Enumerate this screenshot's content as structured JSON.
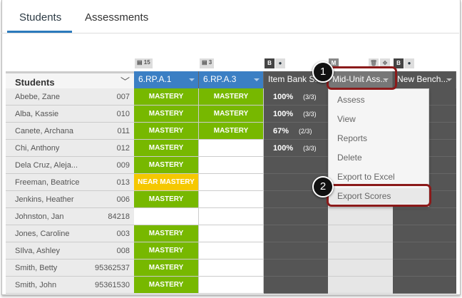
{
  "tabs": [
    {
      "label": "Students"
    },
    {
      "label": "Assessments"
    }
  ],
  "students_header": "Students",
  "badges": {
    "c1": "15",
    "c2": "3",
    "item_bank": "B",
    "mid_unit": "M",
    "new_bench": "B"
  },
  "columns": [
    {
      "label": "6.RP.A.1",
      "color": "#3b7fc4"
    },
    {
      "label": "6.RP.A.3",
      "color": "#3b7fc4"
    },
    {
      "label": "Item Bank S...",
      "color": "#555555"
    },
    {
      "label": "Mid-Unit Ass...",
      "color": "#777777"
    },
    {
      "label": "New Bench...",
      "color": "#555555"
    }
  ],
  "rows": [
    {
      "name": "Abebe, Zane",
      "id": "007",
      "c1": "MASTERY",
      "c2": "MASTERY",
      "pct": "100%",
      "frac": "(3/3)"
    },
    {
      "name": "Alba, Kassie",
      "id": "010",
      "c1": "MASTERY",
      "c2": "MASTERY",
      "pct": "100%",
      "frac": "(3/3)"
    },
    {
      "name": "Canete, Archana",
      "id": "011",
      "c1": "MASTERY",
      "c2": "MASTERY",
      "pct": "67%",
      "frac": "(2/3)"
    },
    {
      "name": "Chi, Anthony",
      "id": "012",
      "c1": "MASTERY",
      "c2": "",
      "pct": "100%",
      "frac": "(3/3)"
    },
    {
      "name": "Dela Cruz, Aleja...",
      "id": "009",
      "c1": "MASTERY",
      "c2": "",
      "pct": "",
      "frac": ""
    },
    {
      "name": "Freeman, Beatrice",
      "id": "013",
      "c1": "NEAR MASTERY",
      "c2": "",
      "pct": "",
      "frac": ""
    },
    {
      "name": "Jenkins, Heather",
      "id": "006",
      "c1": "MASTERY",
      "c2": "",
      "pct": "",
      "frac": ""
    },
    {
      "name": "Johnston, Jan",
      "id": "84218",
      "c1": "",
      "c2": "",
      "pct": "",
      "frac": ""
    },
    {
      "name": "Jones, Caroline",
      "id": "003",
      "c1": "MASTERY",
      "c2": "",
      "pct": "",
      "frac": ""
    },
    {
      "name": "SIlva, Ashley",
      "id": "008",
      "c1": "MASTERY",
      "c2": "",
      "pct": "",
      "frac": ""
    },
    {
      "name": "Smith, Betty",
      "id": "95362537",
      "c1": "MASTERY",
      "c2": "",
      "pct": "",
      "frac": ""
    },
    {
      "name": "Smith, John",
      "id": "95361530",
      "c1": "MASTERY",
      "c2": "",
      "pct": "",
      "frac": ""
    }
  ],
  "menu": [
    "Assess",
    "View",
    "Reports",
    "Delete",
    "Export to Excel",
    "Export Scores"
  ],
  "callouts": [
    "1",
    "2"
  ],
  "colors": {
    "mastery": "#77b800",
    "near": "#f5c800",
    "dark": "#555555",
    "light": "#e6e6e6"
  }
}
